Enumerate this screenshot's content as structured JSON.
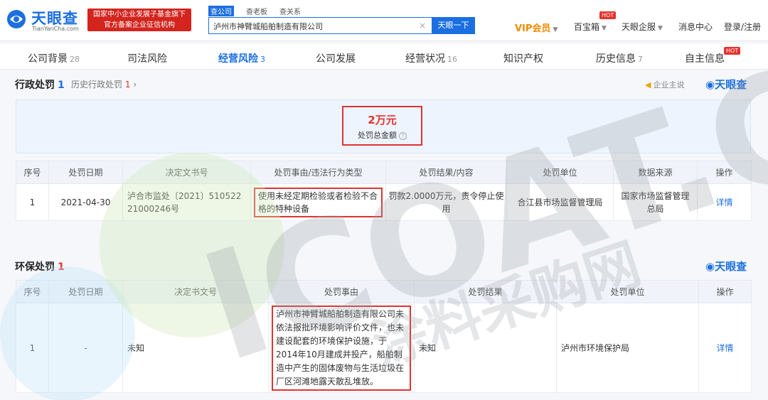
{
  "header": {
    "logo_name": "天眼查",
    "logo_sub": "TianYanCha.com",
    "gov_badge_line1": "国家中小企业发展子基金旗下",
    "gov_badge_line2": "官方备案企业征信机构",
    "search_tabs": [
      "查公司",
      "查老板",
      "查关系"
    ],
    "search_value": "泸州市神臂城船舶制造有限公司",
    "search_button": "天眼一下",
    "nav": {
      "vip": "VIP会员",
      "baibao": "百宝箱",
      "qifu": "天眼企服",
      "messages": "消息中心",
      "login": "登录/注册"
    },
    "hot_tag": "HOT"
  },
  "tabs": [
    {
      "label": "公司背景",
      "count": "28"
    },
    {
      "label": "司法风险",
      "count": ""
    },
    {
      "label": "经营风险",
      "count": "3"
    },
    {
      "label": "公司发展",
      "count": ""
    },
    {
      "label": "经营状况",
      "count": "16"
    },
    {
      "label": "知识产权",
      "count": ""
    },
    {
      "label": "历史信息",
      "count": "7"
    },
    {
      "label": "自主信息",
      "count": ""
    }
  ],
  "tab_hot": "HOT",
  "admin_penalty": {
    "title": "行政处罚",
    "count": "1",
    "history_label": "历史行政处罚",
    "history_count": "1",
    "owner_link": "企业主说",
    "brand": "天眼查",
    "summary_value": "2万元",
    "summary_label": "处罚总金额",
    "columns": [
      "序号",
      "处罚日期",
      "决定文书号",
      "处罚事由/违法行为类型",
      "处罚结果/内容",
      "处罚单位",
      "数据来源",
      "操作"
    ],
    "rows": [
      {
        "index": "1",
        "date": "2021-04-30",
        "doc_no": "泸合市监处〔2021〕51052221000246号",
        "reason": "使用未经定期检验或者检验不合格的特种设备",
        "result": "罚款2.0000万元，责令停止使用",
        "unit": "合江县市场监督管理局",
        "source": "国家市场监督管理总局",
        "action": "详情"
      }
    ]
  },
  "env_penalty": {
    "title": "环保处罚",
    "count": "1",
    "brand": "天眼查",
    "columns": [
      "序号",
      "处罚日期",
      "决定书文号",
      "处罚事由",
      "处罚结果",
      "处罚单位",
      "操作"
    ],
    "rows": [
      {
        "index": "1",
        "date": "-",
        "doc_no": "未知",
        "reason": "泸州市神臂城船舶制造有限公司未依法报批环境影响评价文件，也未建设配套的环境保护设施，于2014年10月建成并投产，船舶制造中产生的固体废物与生活垃圾在厂区河滩地露天散乱堆放。",
        "result": "未知",
        "unit": "泸州市环境保护局",
        "action": "详情"
      }
    ]
  },
  "watermark": {
    "text1": "ICOAT.CC",
    "text2": "涂料采购网"
  },
  "colors": {
    "brand_blue": "#1c6fe0",
    "alert_red": "#e5322d",
    "badge_red": "#d3241e",
    "vip_orange": "#f08c00"
  }
}
